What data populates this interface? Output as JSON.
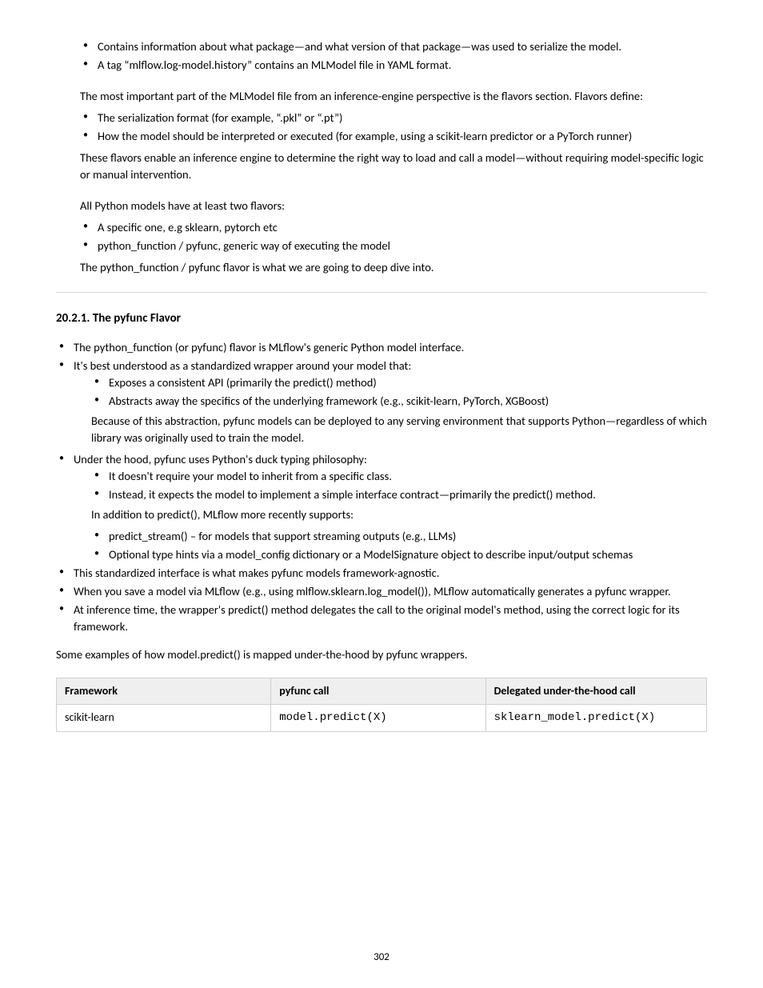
{
  "blocks": {
    "intro": [
      "Contains information about what package—and what version of that package—was used to serialize the model.",
      "A tag “mlflow.log-model.history” contains an MLModel file in YAML format."
    ],
    "flavors_intro": "The most important part of the MLModel file from an inference-engine perspective is the flavors section. Flavors define:",
    "flavors": [
      "The serialization format (for example, “.pkl” or “.pt”)",
      "How the model should be interpreted or executed (for example, using a scikit-learn predictor or a PyTorch runner)"
    ],
    "flavors_outro": "These flavors enable an inference engine to determine the right way to load and call a model—without requiring model-specific logic or manual intervention.",
    "conda_intro": "All Python models have at least two flavors:",
    "conda": [
      "A specific one, e.g sklearn, pytorch etc",
      "python_function / pyfunc, generic way of executing the model"
    ],
    "conda_outro": "The python_function / pyfunc flavor is what we are going to deep dive into."
  },
  "pyfunc": {
    "heading": "20.2.1. The pyfunc Flavor",
    "bullets1": [
      "The python_function (or pyfunc) flavor is MLflow's generic Python model interface.",
      "It's best understood as a standardized wrapper around your model that:"
    ],
    "sub1": [
      "Exposes a consistent API (primarily the predict() method)",
      "Abstracts away the specifics of the underlying framework (e.g., scikit-learn, PyTorch, XGBoost)"
    ],
    "between1": "Because of this abstraction, pyfunc models can be deployed to any serving environment that supports Python—regardless of which library was originally used to train the model.",
    "bullets2": [
      "Under the hood, pyfunc uses Python's duck typing philosophy:"
    ],
    "sub2": [
      "It doesn't require your model to inherit from a specific class.",
      "Instead, it expects the model to implement a simple interface contract—primarily the predict() method."
    ],
    "between2": "In addition to predict(), MLflow more recently supports:",
    "bullets3": [
      "predict_stream() – for models that support streaming outputs (e.g., LLMs)",
      "Optional type hints via a model_config dictionary or a ModelSignature object to describe input/output schemas"
    ],
    "bullets4": [
      "This standardized interface is what makes pyfunc models framework-agnostic.",
      "When you save a model via MLflow (e.g., using mlflow.sklearn.log_model()), MLflow automatically generates a pyfunc wrapper.",
      "At inference time, the wrapper's predict() method delegates the call to the original model's method, using the correct logic for its framework."
    ],
    "table_intro": "Some examples of how model.predict() is mapped under-the-hood by pyfunc wrappers.",
    "table": {
      "headers": [
        "Framework",
        "pyfunc call",
        "Delegated under-the-hood call"
      ],
      "rows": [
        [
          "scikit-learn",
          "model.predict(X)",
          "sklearn_model.predict(X)"
        ]
      ]
    }
  },
  "page_number": "302"
}
